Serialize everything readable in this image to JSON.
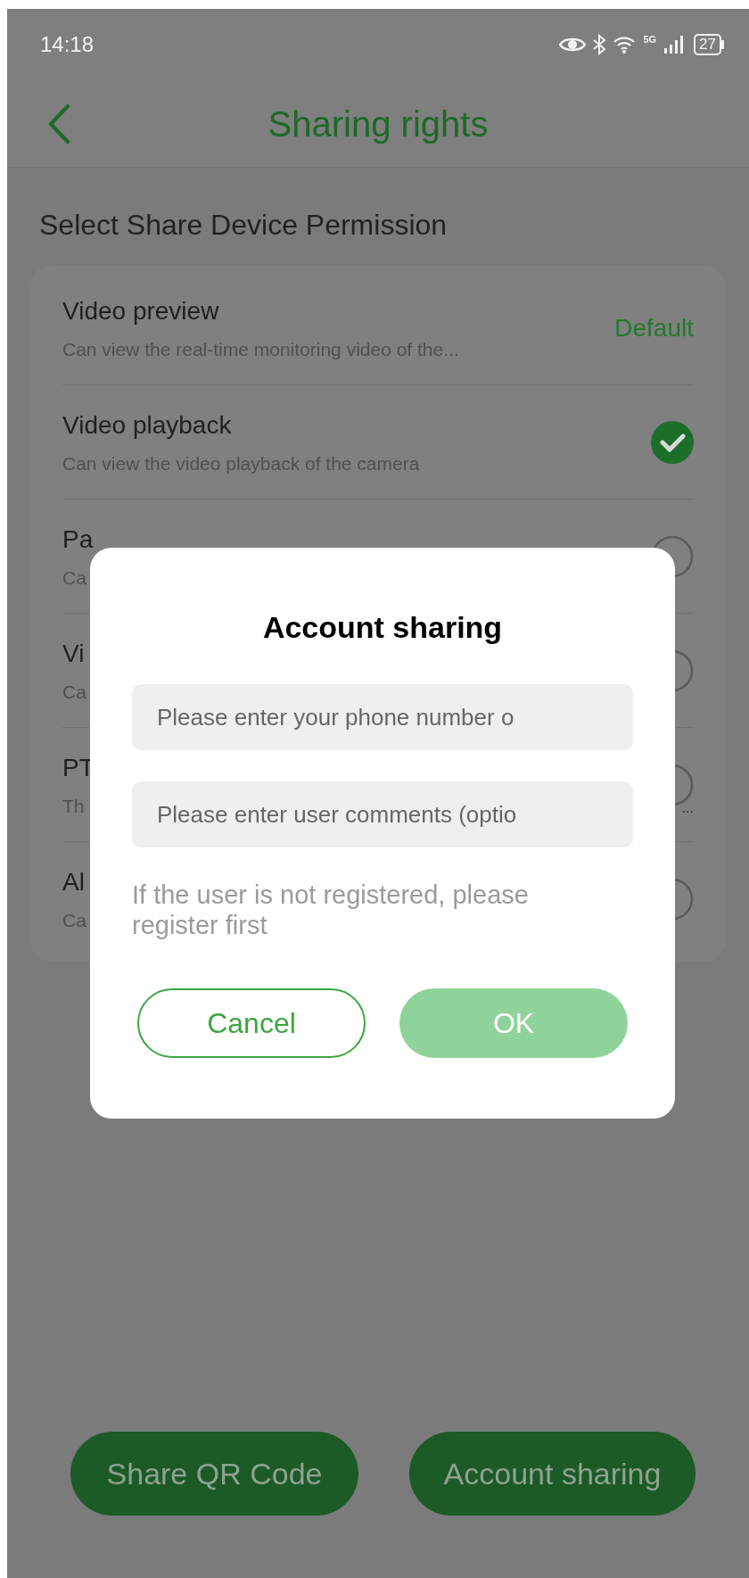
{
  "status_bar": {
    "time": "14:18",
    "network": "5G",
    "battery": "27"
  },
  "header": {
    "title": "Sharing rights"
  },
  "section_title": "Select Share Device Permission",
  "permissions": [
    {
      "title": "Video preview",
      "subtitle": "Can view the real-time monitoring video of the...",
      "kind": "label",
      "badge": "Default"
    },
    {
      "title": "Video playback",
      "subtitle": "Can view the video playback of the camera",
      "kind": "toggle",
      "checked": true
    },
    {
      "title": "Pa",
      "subtitle": "Ca",
      "kind": "toggle",
      "checked": false
    },
    {
      "title": "Vi",
      "subtitle": "Ca",
      "kind": "toggle",
      "checked": false
    },
    {
      "title": "PT",
      "subtitle": "Th",
      "kind": "toggle",
      "checked": false,
      "tail": "..."
    },
    {
      "title": "Al",
      "subtitle": "Ca",
      "kind": "toggle",
      "checked": false
    }
  ],
  "bottom_buttons": [
    "Share QR Code",
    "Account sharing"
  ],
  "dialog": {
    "title": "Account sharing",
    "fields": [
      {
        "placeholder": "Please enter your phone number o"
      },
      {
        "placeholder": "Please enter user comments (optio"
      }
    ],
    "note": "If the user is not registered, please register first",
    "cancel": "Cancel",
    "ok": "OK"
  }
}
